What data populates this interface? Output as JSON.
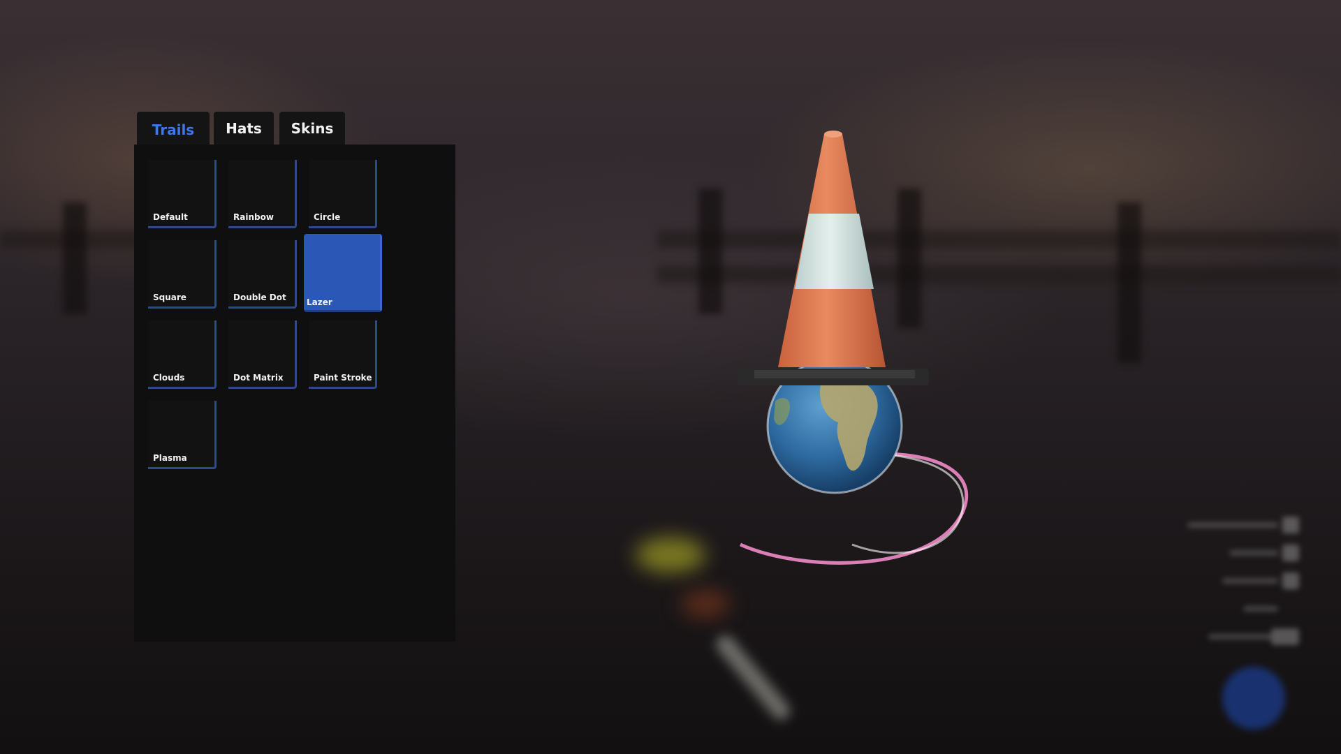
{
  "tabs": [
    {
      "label": "Trails",
      "active": true
    },
    {
      "label": "Hats",
      "active": false
    },
    {
      "label": "Skins",
      "active": false
    }
  ],
  "trails": [
    {
      "label": "Default",
      "selected": false
    },
    {
      "label": "Rainbow",
      "selected": false
    },
    {
      "label": "Circle",
      "selected": false
    },
    {
      "label": "Square",
      "selected": false
    },
    {
      "label": "Double Dot",
      "selected": false
    },
    {
      "label": "Lazer",
      "selected": true
    },
    {
      "label": "Clouds",
      "selected": false
    },
    {
      "label": "Dot Matrix",
      "selected": false
    },
    {
      "label": "Paint Stroke",
      "selected": false
    },
    {
      "label": "Plasma",
      "selected": false
    }
  ],
  "preview": {
    "hat": "traffic-cone",
    "ball_skin": "earth",
    "trail": "Lazer"
  },
  "colors": {
    "accent": "#3c78ee",
    "selected_tile": "#2b57b6",
    "tile_border": "#2d4a8a",
    "panel_bg": "#0f0f0f",
    "cone_orange": "#e07650",
    "cone_stripe": "#d6e4e2",
    "trail_pink": "#f08cc8"
  }
}
